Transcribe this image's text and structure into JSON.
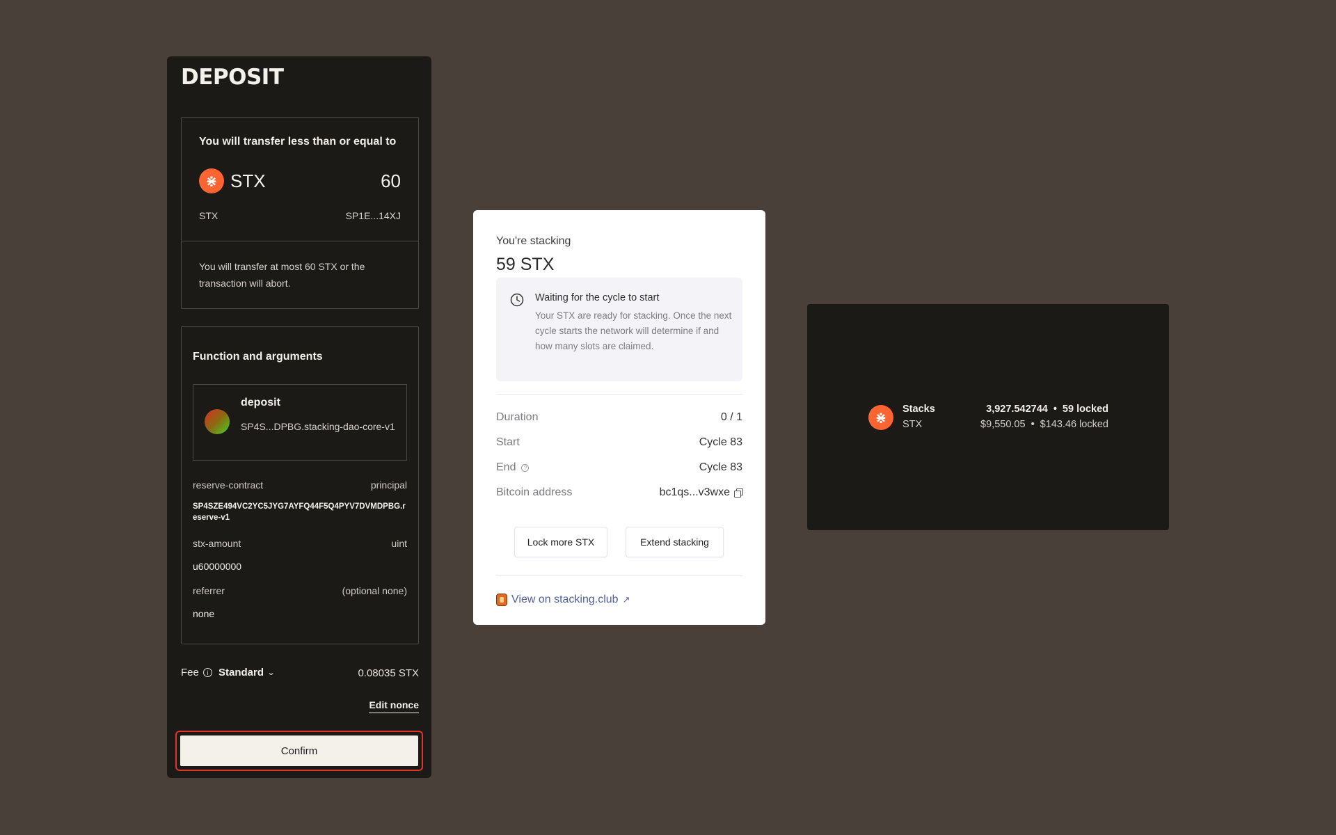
{
  "deposit": {
    "title": "DEPOSIT",
    "transfer": {
      "heading": "You will transfer less than or equal to",
      "token": "STX",
      "amount": "60",
      "symbol": "STX",
      "address": "SP1E...14XJ",
      "note": "You will transfer at most 60 STX or the transaction will abort."
    },
    "function": {
      "heading": "Function and arguments",
      "name": "deposit",
      "contract": "SP4S...DPBG.stacking-dao-core-v1",
      "args": [
        {
          "name": "reserve-contract",
          "type": "principal",
          "value": "SP4SZE494VC2YC5JYG7AYFQ44F5Q4PYV7DVMDPBG.reserve-v1"
        },
        {
          "name": "stx-amount",
          "type": "uint",
          "value": "u60000000"
        },
        {
          "name": "referrer",
          "type": "(optional none)",
          "value": "none"
        }
      ]
    },
    "fee": {
      "label": "Fee",
      "speed": "Standard",
      "amount": "0.08035 STX"
    },
    "edit_nonce": "Edit nonce",
    "confirm": "Confirm"
  },
  "stacking": {
    "label": "You're stacking",
    "amount": "59 STX",
    "status_title": "Waiting for the cycle to start",
    "status_body": "Your STX are ready for stacking. Once the next cycle starts the network will determine if and how many slots are claimed.",
    "rows": [
      {
        "label": "Duration",
        "value": "0 / 1"
      },
      {
        "label": "Start",
        "value": "Cycle 83"
      },
      {
        "label": "End",
        "value": "Cycle 83"
      },
      {
        "label": "Bitcoin address",
        "value": "bc1qs...v3wxe"
      }
    ],
    "lock_more": "Lock more STX",
    "extend": "Extend stacking",
    "link": "View on stacking.club"
  },
  "balance": {
    "name": "Stacks",
    "symbol": "STX",
    "amount": "3,927.542744",
    "locked": "59 locked",
    "fiat": "$9,550.05",
    "fiat_locked": "$143.46 locked",
    "separator": "•"
  },
  "colors": {
    "background": "#4a403a",
    "panel": "#1c1a17",
    "stx_orange": "#fc6432",
    "confirm_highlight": "#e2322c",
    "link": "#4f5f9a"
  },
  "icons": {
    "stx": "stx-logo-icon",
    "info": "info-icon",
    "chevron": "chevron-down-icon",
    "clock": "clock-icon",
    "help": "question-icon",
    "copy": "copy-icon",
    "external": "external-link-icon"
  }
}
